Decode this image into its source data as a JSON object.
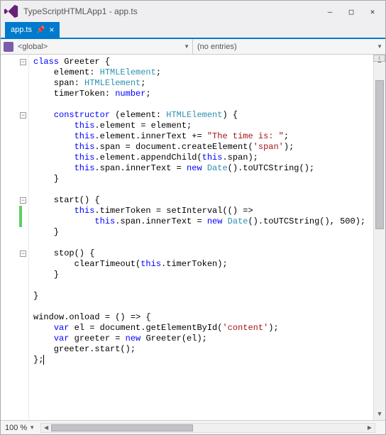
{
  "titlebar": {
    "title": "TypeScriptHTMLApp1 - app.ts"
  },
  "tab": {
    "label": "app.ts"
  },
  "nav": {
    "scope": "<global>",
    "members": "(no entries)"
  },
  "code": {
    "lines": [
      {
        "fold": true,
        "html": "<span class='kw'>class</span> Greeter {"
      },
      {
        "html": "    element: <span class='typ'>HTMLElement</span>;"
      },
      {
        "html": "    span: <span class='typ'>HTMLElement</span>;"
      },
      {
        "html": "    timerToken: <span class='kw'>number</span>;"
      },
      {
        "html": ""
      },
      {
        "fold": true,
        "html": "    <span class='kw'>constructor</span> (element: <span class='typ'>HTMLElement</span>) {"
      },
      {
        "html": "        <span class='kw'>this</span>.element = element;"
      },
      {
        "html": "        <span class='kw'>this</span>.element.innerText += <span class='str'>\"The time is: \"</span>;"
      },
      {
        "html": "        <span class='kw'>this</span>.span = document.createElement(<span class='str'>'span'</span>);"
      },
      {
        "html": "        <span class='kw'>this</span>.element.appendChild(<span class='kw'>this</span>.span);"
      },
      {
        "html": "        <span class='kw'>this</span>.span.innerText = <span class='kw'>new</span> <span class='typ'>Date</span>().toUTCString();"
      },
      {
        "html": "    }"
      },
      {
        "html": ""
      },
      {
        "fold": true,
        "html": "    start() {"
      },
      {
        "change": true,
        "html": "        <span class='kw'>this</span>.timerToken = setInterval(() =>"
      },
      {
        "change": true,
        "html": "            <span class='kw'>this</span>.span.innerText = <span class='kw'>new</span> <span class='typ'>Date</span>().toUTCString(), <span class='num'>500</span>);"
      },
      {
        "html": "    }"
      },
      {
        "html": ""
      },
      {
        "fold": true,
        "html": "    stop() {"
      },
      {
        "html": "        clearTimeout(<span class='kw'>this</span>.timerToken);"
      },
      {
        "html": "    }"
      },
      {
        "html": ""
      },
      {
        "html": "}"
      },
      {
        "html": ""
      },
      {
        "html": "window.onload = () => {"
      },
      {
        "html": "    <span class='kw'>var</span> el = document.getElementById(<span class='str'>'content'</span>);"
      },
      {
        "html": "    <span class='kw'>var</span> greeter = <span class='kw'>new</span> Greeter(el);"
      },
      {
        "html": "    greeter.start();"
      },
      {
        "html": "};<span class='cursor'></span>"
      }
    ]
  },
  "status": {
    "zoom": "100 %"
  }
}
